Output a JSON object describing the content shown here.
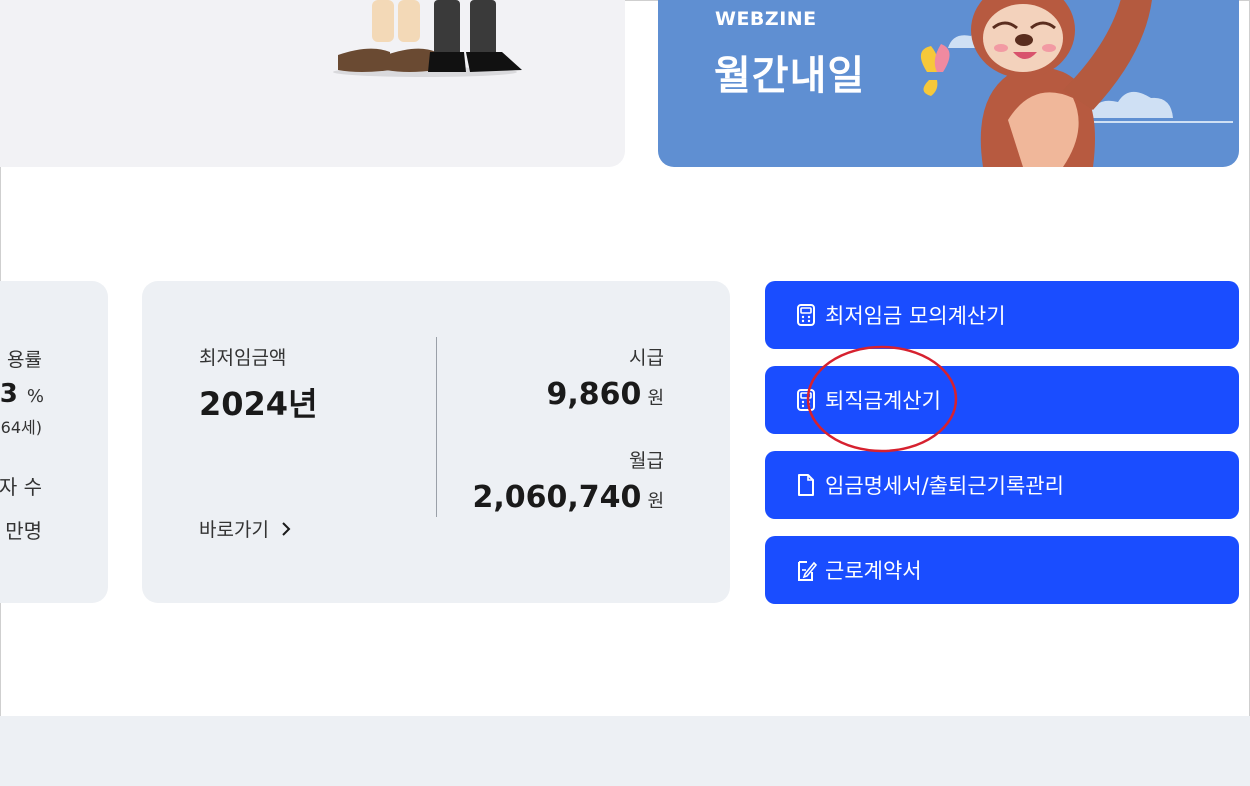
{
  "webzine": {
    "sub": "WEBZINE",
    "title": "월간내일"
  },
  "stats_left": {
    "line1": "용률",
    "line2_value": "3",
    "line2_unit": "%",
    "line3": "64세)",
    "line4": "자 수",
    "line5": "만명"
  },
  "wage": {
    "label": "최저임금액",
    "year": "2024년",
    "goto": "바로가기",
    "hourly_label": "시급",
    "hourly_value": "9,860",
    "monthly_label": "월급",
    "monthly_value": "2,060,740",
    "unit": "원"
  },
  "buttons": [
    {
      "label": "최저임금 모의계산기",
      "icon": "calculator-icon"
    },
    {
      "label": "퇴직금계산기",
      "icon": "calculator-icon"
    },
    {
      "label": "임금명세서/출퇴근기록관리",
      "icon": "document-icon"
    },
    {
      "label": "근로계약서",
      "icon": "edit-document-icon"
    }
  ],
  "colors": {
    "button_blue": "#1a4dff",
    "card_gray": "#edf0f4",
    "webzine_blue": "#5f8fd2",
    "highlight_red": "#d6212f"
  }
}
